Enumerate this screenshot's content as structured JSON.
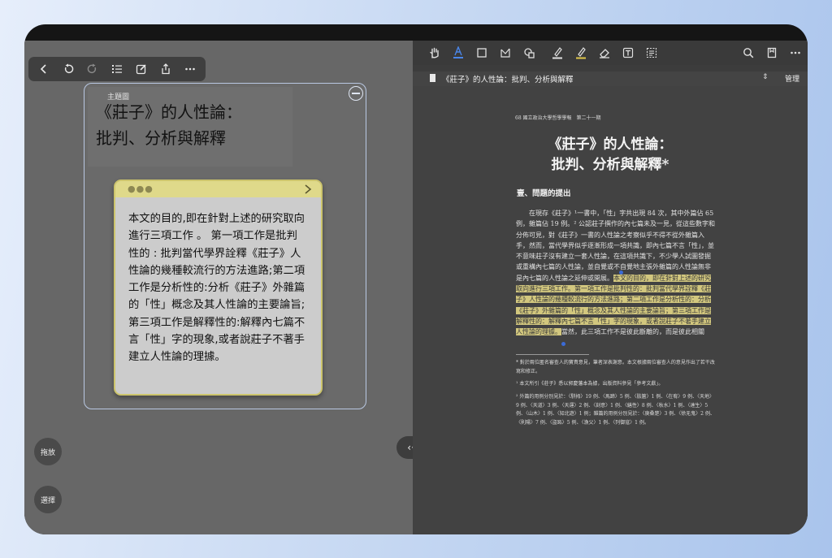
{
  "left_toolbar": {
    "icons": [
      "back-icon",
      "undo-icon",
      "redo-icon",
      "list-icon",
      "edit-icon",
      "share-icon",
      "more-icon"
    ]
  },
  "mindmap": {
    "title_label": "主題圖",
    "title_text": "《莊子》的人性論：\n批判、分析與解釋",
    "sticky_text": "本文的目的,即在針對上述的研究取向進行三項工作 。 第一項工作是批判性的 : 批判當代學界詮釋《莊子》人性論的幾種較流行的方法進路;第二項工作是分析性的:分析《莊子》外雜篇的「性」概念及其人性論的主要論旨;第三項工作是解釋性的:解釋內七篇不言「性」字的現象,或者說莊子不著手建立人性論的理據。"
  },
  "buttons": {
    "drag": "拖放",
    "select": "選擇",
    "divider": "‹·›"
  },
  "pdf_toolbar": {
    "tools": [
      "hand-icon",
      "text-highlight-icon",
      "rect-select-icon",
      "lasso-icon",
      "shapes-icon",
      "pen-icon",
      "highlighter-icon",
      "eraser-icon",
      "textbox-icon",
      "ocr-icon"
    ],
    "right_tools": [
      "search-icon",
      "bookmark-icon",
      "more-icon"
    ],
    "accent": "#4a86e8"
  },
  "doc_tab": {
    "name": "《莊子》的人性論：批判、分析與解釋",
    "sort": "⇕",
    "manage": "管理"
  },
  "pdf_page": {
    "header": "68  國立政治大學哲學學報　第二十一期",
    "title": "《莊子》的人性論：\n批判、分析與解釋*",
    "section": "壹、問題的提出",
    "body_plain": "　　在現存《莊子》¹一書中，「性」字共出現 84 次，其中外篇佔 65 例，雜篇佔 19 例。² 公認莊子撰作的內七篇未及一見，從這些數字和分佈可見，對《莊子》一書的人性論之考察似乎不得不從外雜篇入手，然而，當代學界似乎逐漸形成一項共識，即內七篇不言「性」，並不意味莊子沒有建立一套人性論，在這項共識下，不少學人試圖發掘或重構內七篇的人性論，並自覺或不自覺地主張外雜篇的人性論無非是內七篇的人性論之延伸或開展。",
    "body_highlight": "本文的目的，即在針對上述的研究取向進行三項工作。第一項工作是批判性的：批判當代學界詮釋《莊子》人性論的幾種較流行的方法進路；第二項工作是分析性的：分析《莊子》外雜篇的「性」概念及其人性論的主要論旨；第三項工作是解釋性的：解釋內七篇不言「性」字的現象，或者說莊子不著手建立人性論的理據。",
    "body_tail": "當然，此三項工作不是彼此斷離的，而是彼此相關",
    "footnote_star": "* 對於兩位匿名審查人的寶貴意見，筆者深表謝意。本文根據兩位審查人的意見作出了若干改寫和修正。",
    "footnote_1": "¹ 本文所引《莊子》悉以郭慶藩本為據，出版資料參見「參考文獻」。",
    "footnote_2": "² 外篇的用例分別見於：〈駢拇〉19 例、〈馬蹄〉5 例、〈胠篋〉1 例、〈在宥〉9 例、〈天地〉9 例、〈天道〉3 例、〈天運〉2 例、〈刻意〉1 例、〈繕性〉8 例、〈秋水〉1 例、〈達生〉5 例、〈山木〉1 例、〈知北遊〉1 例；雜篇的用例分別見於：〈庚桑楚〉3 例、〈徐无鬼〉2 例、〈則陽〉7 例、〈盜跖〉5 例、〈漁父〉1 例、〈列御寇〉1 例。"
  }
}
